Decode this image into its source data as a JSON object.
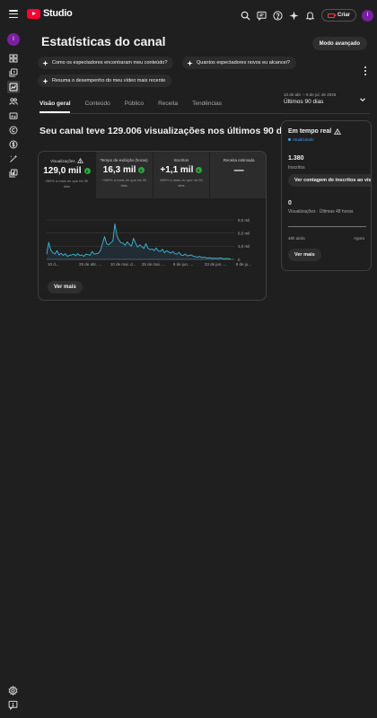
{
  "app": {
    "logo_text": "Studio",
    "create_label": "Criar",
    "avatar_letter": "I",
    "brand_color": "#ff0033",
    "accent_color": "#3ea6ff",
    "positive_color": "#2ba640"
  },
  "topbar_icons": [
    "search-icon",
    "feedback-icon",
    "help-icon",
    "sparkle-icon",
    "bell-icon"
  ],
  "rail": {
    "avatar_letter": "I",
    "items": [
      "dashboard-icon",
      "content-icon",
      "analytics-icon",
      "community-icon",
      "subtitles-icon",
      "copyright-icon",
      "earn-icon",
      "customization-icon",
      "audio-library-icon"
    ],
    "bottom": [
      "settings-icon",
      "feedback-icon"
    ]
  },
  "page": {
    "title": "Estatísticas do canal",
    "advanced_button": "Modo avançado",
    "chips": [
      "Como os espectadores encontraram meu conteúdo?",
      "Quantos espectadores novos eu alcancei?",
      "Resuma o desempenho do meu vídeo mais recente"
    ],
    "tabs": [
      "Visão geral",
      "Conteúdo",
      "Público",
      "Receita",
      "Tendências"
    ],
    "active_tab": "Visão geral",
    "range_small": "10 de abr. – 8 de jul. de 2026",
    "range_label": "Últimos 90 dias",
    "headline": "Seu canal teve 129.006 visualizações nos últimos 90 dias"
  },
  "metrics": [
    {
      "label": "Visualizações",
      "value": "129,0 mil",
      "note": "289% a mais do que há 90 dias",
      "warning": true,
      "trend": "up"
    },
    {
      "label": "Tempo de exibição (horas)",
      "value": "16,3 mil",
      "note": "+969% a mais do que há 90 dias",
      "warning": false,
      "trend": "up"
    },
    {
      "label": "Inscritos",
      "value": "+1,1 mil",
      "note": "286% a mais do que há 90 dias",
      "warning": false,
      "trend": "up"
    },
    {
      "label": "Receita estimada",
      "value": "—",
      "note": "",
      "warning": false,
      "trend": ""
    }
  ],
  "chart_data": {
    "type": "line",
    "x_tick_labels": [
      "10 d...",
      "25 de abr. ...",
      "10 de mai. d...",
      "25 de mai. ...",
      "8 de jun. ...",
      "23 de jun. ...",
      "8 de ju..."
    ],
    "y_tick_labels": [
      "9,0 mil",
      "6,0 mil",
      "3,0 mil",
      "0"
    ],
    "ylim": [
      0,
      9000
    ],
    "series": [
      {
        "values": [
          1200,
          3900,
          2100,
          1500,
          1200,
          2000,
          1000,
          1400,
          900,
          1300,
          700,
          900,
          1000,
          1200,
          800,
          1300,
          900,
          1000,
          700,
          1200,
          1100,
          900,
          1800,
          1200,
          1300,
          1400,
          2000,
          3600,
          5200,
          3600,
          3300,
          3800,
          4200,
          8100,
          5400,
          4300,
          3800,
          3700,
          3200,
          4000,
          3400,
          3000,
          4800,
          3700,
          2800,
          3300,
          2900,
          2500,
          3600,
          2600,
          2200,
          2400,
          2000,
          2600,
          1900,
          1800,
          2300,
          1500,
          2000,
          1700,
          1400,
          1800,
          1300,
          1200,
          1600,
          1000,
          900,
          1200,
          800,
          900,
          1000,
          700,
          600,
          500,
          700,
          400,
          500,
          400,
          300,
          400,
          200,
          300,
          250,
          200,
          350,
          200,
          150,
          200,
          150,
          100
        ]
      }
    ],
    "grid": true
  },
  "more_label": "Ver mais",
  "realtime": {
    "title": "Em tempo real",
    "status": "Atualizando",
    "subs_value": "1.380",
    "subs_label": "Inscritos",
    "subs_button": "Ver contagem de inscritos ao vivo",
    "views_value": "0",
    "views_label": "Visualizações · Últimas 48 horas",
    "axis_left": "48h atrás",
    "axis_right": "Agora",
    "more_label": "Ver mais"
  }
}
